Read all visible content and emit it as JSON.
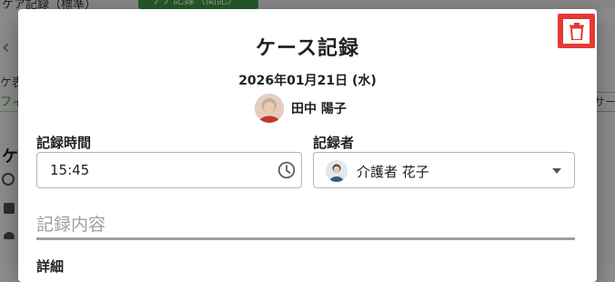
{
  "background": {
    "tab_standard": "ケア記録（標準）",
    "tab_simple": "ケア記録（簡記）",
    "label_a": "ケ表",
    "filter_label": "フィ",
    "chip_label": "サー",
    "section_initial": "ケ"
  },
  "dialog": {
    "title": "ケース記録",
    "date": "2026年01月21日 (水)",
    "resident_name": "田中 陽子",
    "record_time": {
      "label": "記録時間",
      "value": "15:45"
    },
    "recorder": {
      "label": "記録者",
      "value": "介護者 花子"
    },
    "section_title": "記録内容",
    "detail_label": "詳細",
    "icons": {
      "delete": "trash-icon",
      "time": "clock-icon",
      "dropdown": "caret-down-icon"
    }
  },
  "colors": {
    "delete_highlight": "#e53935",
    "accent_green": "#43a047",
    "text": "#212121",
    "muted": "#9e9e9e"
  }
}
